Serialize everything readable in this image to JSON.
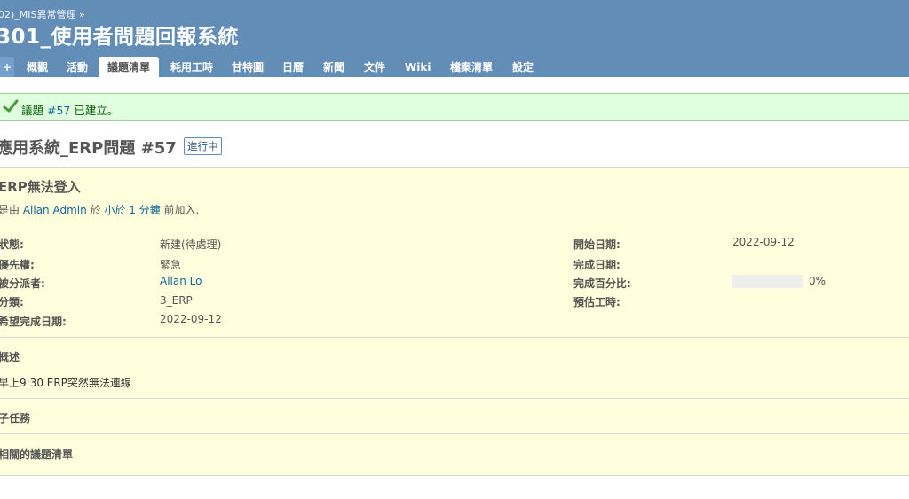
{
  "header": {
    "breadcrumb": "02)_MIS異常管理 »",
    "project_title": "301_使用者問題回報系統"
  },
  "menu": {
    "plus": "+",
    "tabs": [
      {
        "label": "概觀"
      },
      {
        "label": "活動"
      },
      {
        "label": "議題清單",
        "selected": true
      },
      {
        "label": "耗用工時"
      },
      {
        "label": "甘特圖"
      },
      {
        "label": "日曆"
      },
      {
        "label": "新聞"
      },
      {
        "label": "文件"
      },
      {
        "label": "Wiki"
      },
      {
        "label": "檔案清單"
      },
      {
        "label": "設定"
      }
    ]
  },
  "flash": {
    "prefix": "議題 ",
    "issue_link": "#57",
    "suffix": " 已建立。"
  },
  "issue": {
    "heading": "應用系統_ERP問題 #57",
    "status_badge": "進行中",
    "subject": "ERP無法登入",
    "author_prefix": "是由 ",
    "author_name": "Allan Admin",
    "author_mid": " 於 ",
    "author_time": "小於 1 分鐘",
    "author_suffix": " 前加入.",
    "attributes_left": [
      {
        "label": "狀態:",
        "value": "新建(待處理)"
      },
      {
        "label": "優先權:",
        "value": "緊急"
      },
      {
        "label": "被分派者:",
        "value": "Allan Lo",
        "is_link": true
      },
      {
        "label": "分類:",
        "value": "3_ERP"
      },
      {
        "label": "希望完成日期:",
        "value": "2022-09-12"
      }
    ],
    "attributes_right": [
      {
        "label": "開始日期:",
        "value": "2022-09-12"
      },
      {
        "label": "完成日期:",
        "value": ""
      },
      {
        "label": "完成百分比:",
        "value": "0%"
      },
      {
        "label": "預估工時:",
        "value": ""
      }
    ],
    "done_ratio": 0,
    "description_title": "概述",
    "description_text": "早上9:30 ERP突然無法連線",
    "subtasks_title": "子任務",
    "relations_title": "相關的議題清單"
  },
  "colors": {
    "header_bg": "#628db6",
    "flash_bg": "#dfffdf",
    "issue_bg": "#ffffdd",
    "link": "#169"
  }
}
